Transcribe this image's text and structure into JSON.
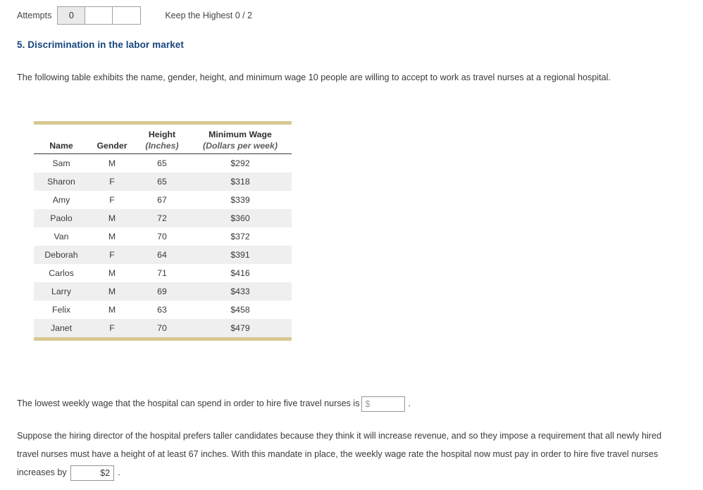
{
  "attempts": {
    "label": "Attempts",
    "boxes": [
      "0",
      "",
      ""
    ],
    "keep_highest": "Keep the Highest 0 / 2"
  },
  "question": {
    "heading": "5. Discrimination in the labor market",
    "intro": "The following table exhibits the name, gender, height, and minimum wage 10 people are willing to accept to work as travel nurses at a regional hospital."
  },
  "table": {
    "headers": {
      "name": "Name",
      "gender": "Gender",
      "height": "Height",
      "height_sub": "(Inches)",
      "wage": "Minimum Wage",
      "wage_sub": "(Dollars per week)"
    },
    "rows": [
      {
        "name": "Sam",
        "gender": "M",
        "height": "65",
        "wage": "$292"
      },
      {
        "name": "Sharon",
        "gender": "F",
        "height": "65",
        "wage": "$318"
      },
      {
        "name": "Amy",
        "gender": "F",
        "height": "67",
        "wage": "$339"
      },
      {
        "name": "Paolo",
        "gender": "M",
        "height": "72",
        "wage": "$360"
      },
      {
        "name": "Van",
        "gender": "M",
        "height": "70",
        "wage": "$372"
      },
      {
        "name": "Deborah",
        "gender": "F",
        "height": "64",
        "wage": "$391"
      },
      {
        "name": "Carlos",
        "gender": "M",
        "height": "71",
        "wage": "$416"
      },
      {
        "name": "Larry",
        "gender": "M",
        "height": "69",
        "wage": "$433"
      },
      {
        "name": "Felix",
        "gender": "M",
        "height": "63",
        "wage": "$458"
      },
      {
        "name": "Janet",
        "gender": "F",
        "height": "70",
        "wage": "$479"
      }
    ]
  },
  "answers": {
    "q1_text": "The lowest weekly wage that the hospital can spend in order to hire five travel nurses is",
    "q1_placeholder": "$",
    "q1_value": "",
    "q1_period": ".",
    "q2_text_before": "Suppose the hiring director of the hospital prefers taller candidates because they think it will increase revenue, and so they impose a requirement that all newly hired travel nurses must have a height of at least 67 inches. With this mandate in place, the weekly wage rate the hospital now must pay in order to hire five travel nurses increases by",
    "q2_value": "$2",
    "q2_period": "."
  },
  "colors": {
    "heading": "#17467c",
    "table_rule": "#d7c893",
    "alt_row": "#efefef"
  }
}
